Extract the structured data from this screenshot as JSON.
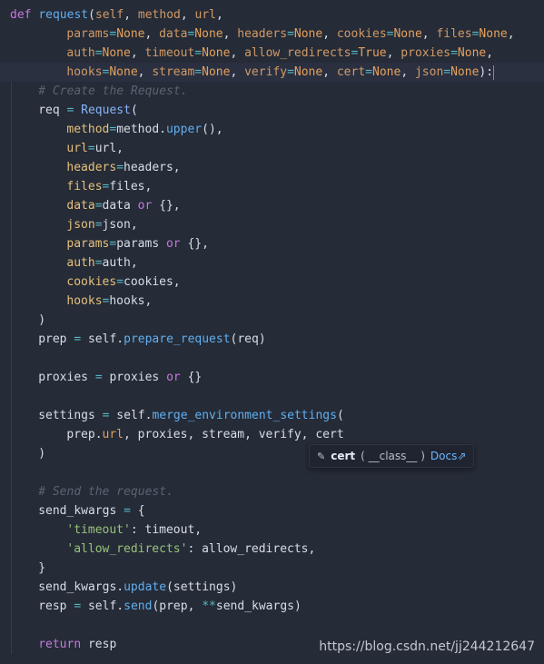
{
  "editor": {
    "language": "python",
    "lines": [
      {
        "indent": 0,
        "tokens": [
          [
            "kw",
            "def"
          ],
          [
            "plain",
            " "
          ],
          [
            "fn",
            "request"
          ],
          [
            "plain",
            "("
          ],
          [
            "prm",
            "self"
          ],
          [
            "plain",
            ", "
          ],
          [
            "prm",
            "method"
          ],
          [
            "plain",
            ", "
          ],
          [
            "prm",
            "url"
          ],
          [
            "plain",
            ","
          ]
        ]
      },
      {
        "indent": 8,
        "tokens": [
          [
            "prm",
            "params"
          ],
          [
            "op",
            "="
          ],
          [
            "none",
            "None"
          ],
          [
            "plain",
            ", "
          ],
          [
            "prm",
            "data"
          ],
          [
            "op",
            "="
          ],
          [
            "none",
            "None"
          ],
          [
            "plain",
            ", "
          ],
          [
            "prm",
            "headers"
          ],
          [
            "op",
            "="
          ],
          [
            "none",
            "None"
          ],
          [
            "plain",
            ", "
          ],
          [
            "prm",
            "cookies"
          ],
          [
            "op",
            "="
          ],
          [
            "none",
            "None"
          ],
          [
            "plain",
            ", "
          ],
          [
            "prm",
            "files"
          ],
          [
            "op",
            "="
          ],
          [
            "none",
            "None"
          ],
          [
            "plain",
            ","
          ]
        ]
      },
      {
        "indent": 8,
        "tokens": [
          [
            "prm",
            "auth"
          ],
          [
            "op",
            "="
          ],
          [
            "none",
            "None"
          ],
          [
            "plain",
            ", "
          ],
          [
            "prm",
            "timeout"
          ],
          [
            "op",
            "="
          ],
          [
            "none",
            "None"
          ],
          [
            "plain",
            ", "
          ],
          [
            "prm",
            "allow_redirects"
          ],
          [
            "op",
            "="
          ],
          [
            "none",
            "True"
          ],
          [
            "plain",
            ", "
          ],
          [
            "prm",
            "proxies"
          ],
          [
            "op",
            "="
          ],
          [
            "none",
            "None"
          ],
          [
            "plain",
            ","
          ]
        ]
      },
      {
        "indent": 8,
        "current": true,
        "tokens": [
          [
            "prm",
            "hooks"
          ],
          [
            "op",
            "="
          ],
          [
            "none",
            "None"
          ],
          [
            "plain",
            ", "
          ],
          [
            "prm",
            "stream"
          ],
          [
            "op",
            "="
          ],
          [
            "none",
            "None"
          ],
          [
            "plain",
            ", "
          ],
          [
            "prm",
            "verify"
          ],
          [
            "op",
            "="
          ],
          [
            "none",
            "None"
          ],
          [
            "plain",
            ", "
          ],
          [
            "prm",
            "cert"
          ],
          [
            "op",
            "="
          ],
          [
            "none",
            "None"
          ],
          [
            "plain",
            ", "
          ],
          [
            "prm",
            "json"
          ],
          [
            "op",
            "="
          ],
          [
            "none",
            "None"
          ],
          [
            "plain",
            "):"
          ]
        ]
      },
      {
        "indent": 4,
        "tokens": [
          [
            "com",
            "# Create the Request."
          ]
        ]
      },
      {
        "indent": 4,
        "tokens": [
          [
            "plain",
            "req "
          ],
          [
            "op",
            "="
          ],
          [
            "plain",
            " "
          ],
          [
            "cls",
            "Request"
          ],
          [
            "plain",
            "("
          ]
        ]
      },
      {
        "indent": 8,
        "tokens": [
          [
            "kwarg",
            "method"
          ],
          [
            "op",
            "="
          ],
          [
            "plain",
            "method."
          ],
          [
            "fn",
            "upper"
          ],
          [
            "plain",
            "(),"
          ]
        ]
      },
      {
        "indent": 8,
        "tokens": [
          [
            "kwarg",
            "url"
          ],
          [
            "op",
            "="
          ],
          [
            "plain",
            "url,"
          ]
        ]
      },
      {
        "indent": 8,
        "tokens": [
          [
            "kwarg",
            "headers"
          ],
          [
            "op",
            "="
          ],
          [
            "plain",
            "headers,"
          ]
        ]
      },
      {
        "indent": 8,
        "tokens": [
          [
            "kwarg",
            "files"
          ],
          [
            "op",
            "="
          ],
          [
            "plain",
            "files,"
          ]
        ]
      },
      {
        "indent": 8,
        "tokens": [
          [
            "kwarg",
            "data"
          ],
          [
            "op",
            "="
          ],
          [
            "plain",
            "data "
          ],
          [
            "kw",
            "or"
          ],
          [
            "plain",
            " {},"
          ]
        ]
      },
      {
        "indent": 8,
        "tokens": [
          [
            "kwarg",
            "json"
          ],
          [
            "op",
            "="
          ],
          [
            "plain",
            "json,"
          ]
        ]
      },
      {
        "indent": 8,
        "tokens": [
          [
            "kwarg",
            "params"
          ],
          [
            "op",
            "="
          ],
          [
            "plain",
            "params "
          ],
          [
            "kw",
            "or"
          ],
          [
            "plain",
            " {},"
          ]
        ]
      },
      {
        "indent": 8,
        "tokens": [
          [
            "kwarg",
            "auth"
          ],
          [
            "op",
            "="
          ],
          [
            "plain",
            "auth,"
          ]
        ]
      },
      {
        "indent": 8,
        "tokens": [
          [
            "kwarg",
            "cookies"
          ],
          [
            "op",
            "="
          ],
          [
            "plain",
            "cookies,"
          ]
        ]
      },
      {
        "indent": 8,
        "tokens": [
          [
            "kwarg",
            "hooks"
          ],
          [
            "op",
            "="
          ],
          [
            "plain",
            "hooks,"
          ]
        ]
      },
      {
        "indent": 4,
        "tokens": [
          [
            "plain",
            ")"
          ]
        ]
      },
      {
        "indent": 4,
        "tokens": [
          [
            "plain",
            "prep "
          ],
          [
            "op",
            "="
          ],
          [
            "plain",
            " self."
          ],
          [
            "fn",
            "prepare_request"
          ],
          [
            "plain",
            "(req)"
          ]
        ]
      },
      {
        "indent": 0,
        "tokens": []
      },
      {
        "indent": 4,
        "tokens": [
          [
            "plain",
            "proxies "
          ],
          [
            "op",
            "="
          ],
          [
            "plain",
            " proxies "
          ],
          [
            "kw",
            "or"
          ],
          [
            "plain",
            " {}"
          ]
        ]
      },
      {
        "indent": 0,
        "tokens": []
      },
      {
        "indent": 4,
        "tokens": [
          [
            "plain",
            "settings "
          ],
          [
            "op",
            "="
          ],
          [
            "plain",
            " self."
          ],
          [
            "fn",
            "merge_environment_settings"
          ],
          [
            "plain",
            "("
          ]
        ]
      },
      {
        "indent": 8,
        "tokens": [
          [
            "plain",
            "prep."
          ],
          [
            "none",
            "url"
          ],
          [
            "plain",
            ", proxies, stream, verify, cert"
          ]
        ]
      },
      {
        "indent": 4,
        "tokens": [
          [
            "plain",
            ")"
          ]
        ]
      },
      {
        "indent": 0,
        "tokens": []
      },
      {
        "indent": 4,
        "tokens": [
          [
            "com",
            "# Send the request."
          ]
        ]
      },
      {
        "indent": 4,
        "tokens": [
          [
            "plain",
            "send_kwargs "
          ],
          [
            "op",
            "="
          ],
          [
            "plain",
            " {"
          ]
        ]
      },
      {
        "indent": 8,
        "tokens": [
          [
            "str",
            "'timeout'"
          ],
          [
            "plain",
            ": timeout,"
          ]
        ]
      },
      {
        "indent": 8,
        "tokens": [
          [
            "str",
            "'allow_redirects'"
          ],
          [
            "plain",
            ": allow_redirects,"
          ]
        ]
      },
      {
        "indent": 4,
        "tokens": [
          [
            "plain",
            "}"
          ]
        ]
      },
      {
        "indent": 4,
        "tokens": [
          [
            "plain",
            "send_kwargs."
          ],
          [
            "fn",
            "update"
          ],
          [
            "plain",
            "(settings)"
          ]
        ]
      },
      {
        "indent": 4,
        "tokens": [
          [
            "plain",
            "resp "
          ],
          [
            "op",
            "="
          ],
          [
            "plain",
            " self."
          ],
          [
            "fn",
            "send"
          ],
          [
            "plain",
            "(prep, "
          ],
          [
            "op",
            "**"
          ],
          [
            "plain",
            "send_kwargs)"
          ]
        ]
      },
      {
        "indent": 0,
        "tokens": []
      },
      {
        "indent": 4,
        "tokens": [
          [
            "kw",
            "return"
          ],
          [
            "plain",
            " resp"
          ]
        ]
      }
    ]
  },
  "hint_popup": {
    "icon": "variable-icon",
    "icon_glyph": "✎",
    "name": "cert",
    "type": "( __class__ )",
    "docs_label": "Docs",
    "docs_arrow": "⇗"
  },
  "watermark": "https://blog.csdn.net/jj244212647"
}
